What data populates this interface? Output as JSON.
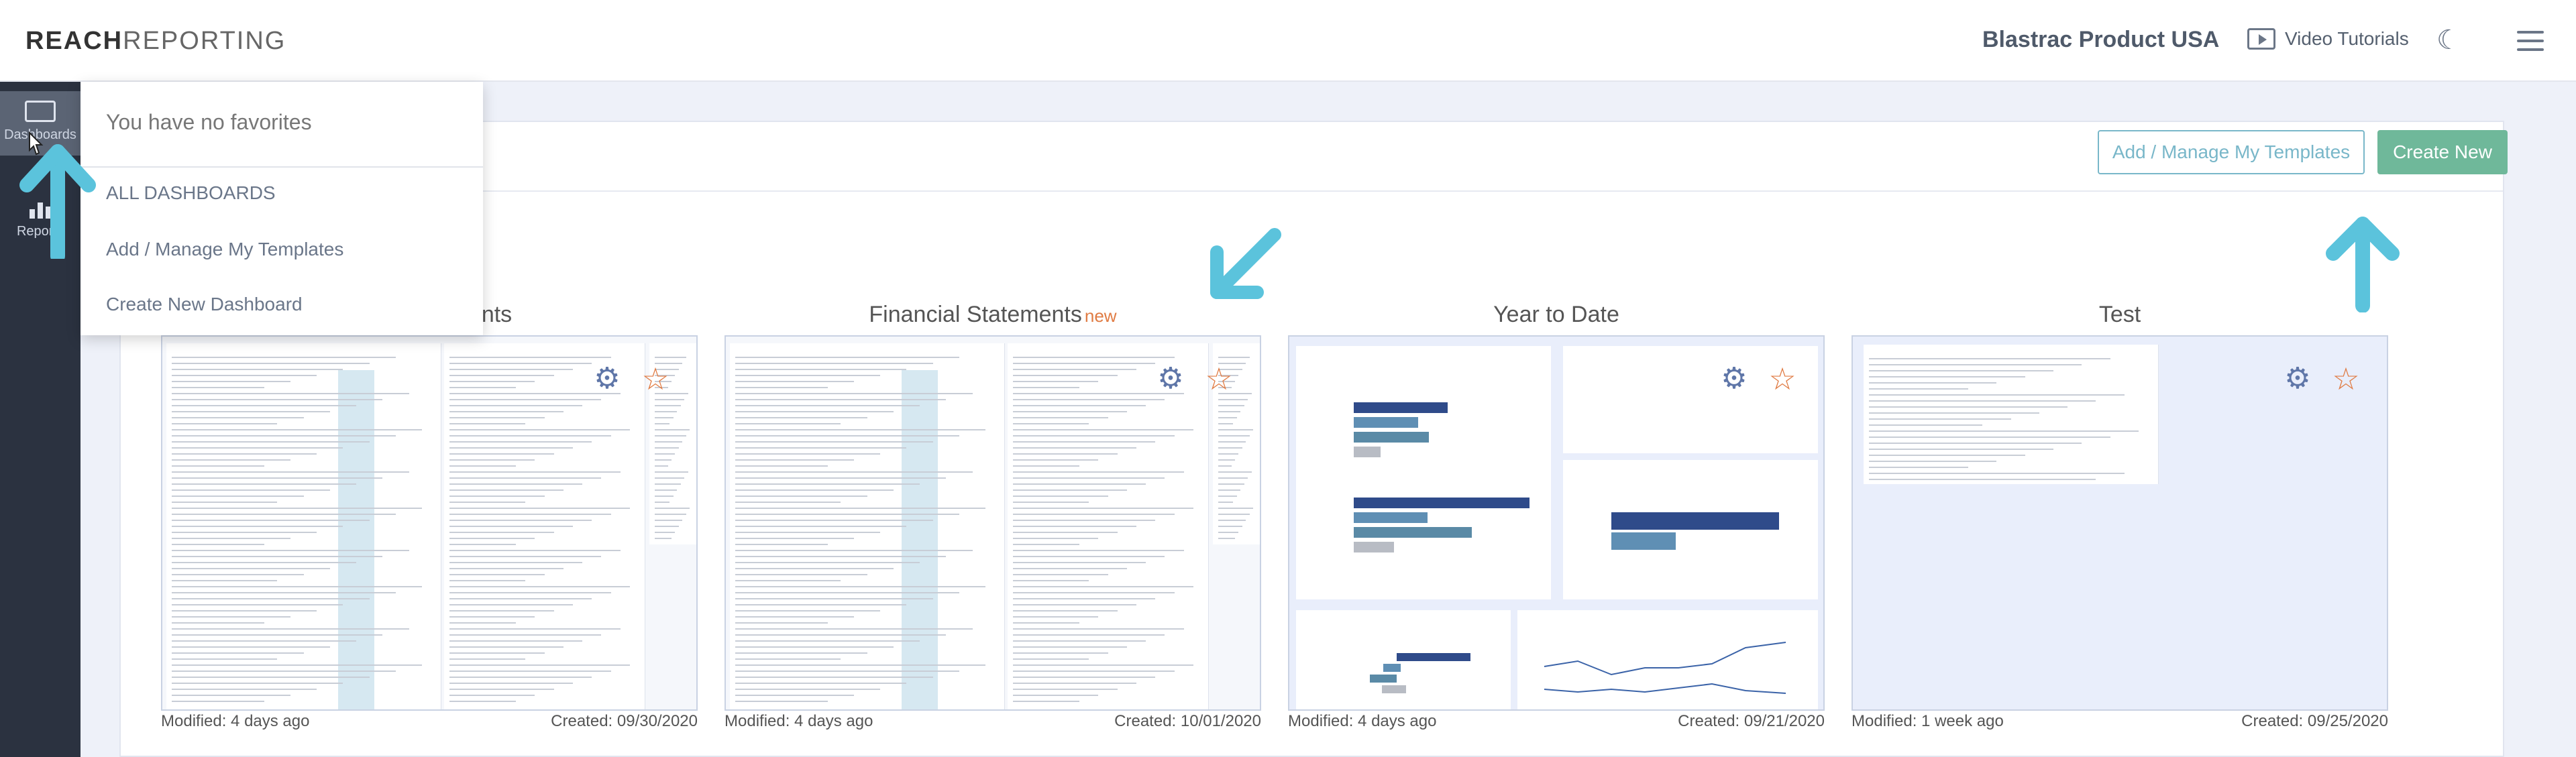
{
  "header": {
    "logo_bold": "REACH",
    "logo_light": "REPORTING",
    "company": "Blastrac Product USA",
    "video_tutorials": "Video Tutorials"
  },
  "rail": {
    "items": [
      {
        "label": "Dashboards",
        "icon": "dashboard-icon"
      },
      {
        "label": "Reports",
        "icon": "bar-chart-icon"
      }
    ]
  },
  "toolbar": {
    "manage_templates": "Add / Manage My Templates",
    "create_new": "Create New"
  },
  "dropdown": {
    "no_favorites": "You have no favorites",
    "all_dashboards": "ALL DASHBOARDS",
    "manage_templates": "Add / Manage My Templates",
    "create_dashboard": "Create New Dashboard"
  },
  "cards": [
    {
      "title": "Financial Statements",
      "visible_title": "nents",
      "badge": "",
      "modified": "Modified: 4 days ago",
      "created": "Created: 09/30/2020"
    },
    {
      "title": "Financial Statements",
      "badge": "new",
      "modified": "Modified: 4 days ago",
      "created": "Created: 10/01/2020"
    },
    {
      "title": "Year to Date",
      "badge": "",
      "modified": "Modified: 4 days ago",
      "created": "Created: 09/21/2020"
    },
    {
      "title": "Test",
      "badge": "",
      "modified": "Modified: 1 week ago",
      "created": "Created: 09/25/2020"
    }
  ],
  "colors": {
    "rail_bg": "#2b3240",
    "accent_green": "#6fb89a",
    "accent_teal": "#79b7c9",
    "star_orange": "#e07b43",
    "gear_blue": "#5f76a8",
    "arrow_cyan": "#5bc3dc"
  }
}
